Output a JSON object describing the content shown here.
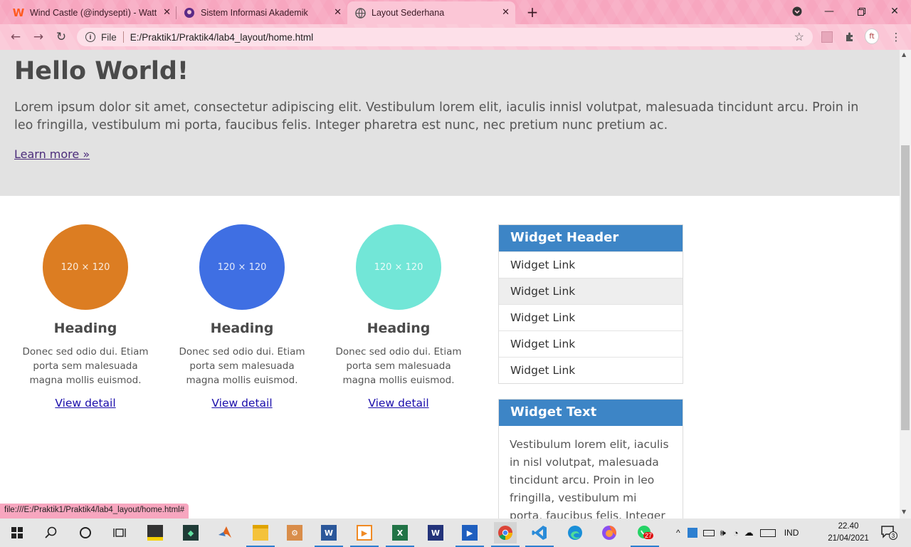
{
  "browser": {
    "tabs": [
      {
        "title": "Wind Castle (@indyseptì) - Wattp",
        "icon": "wattpad-icon",
        "active": false
      },
      {
        "title": "Sistem Informasi Akademik",
        "icon": "academic-icon",
        "active": false
      },
      {
        "title": "Layout Sederhana",
        "icon": "globe-icon",
        "active": true
      }
    ],
    "address": {
      "scheme_label": "File",
      "url": "E:/Praktik1/Praktik4/lab4_layout/home.html"
    },
    "status_url": "file:///E:/Praktik1/Praktik4/lab4_layout/home.html#",
    "theme_color": "#f7a6bf"
  },
  "page": {
    "jumbotron": {
      "title": "Hello World!",
      "text": "Lorem ipsum dolor sit amet, consectetur adipiscing elit. Vestibulum lorem elit, iaculis innisl volutpat, malesuada tincidunt arcu. Proin in leo fringilla, vestibulum mi porta, faucibus felis. Integer pharetra est nunc, nec pretium nunc pretium ac.",
      "link": "Learn more »"
    },
    "features": [
      {
        "placeholder": "120 × 120",
        "color": "#dc7d22",
        "heading": "Heading",
        "text": "Donec sed odio dui. Etiam porta sem malesuada magna mollis euismod.",
        "link": "View detail"
      },
      {
        "placeholder": "120 × 120",
        "color": "#3f6fe3",
        "heading": "Heading",
        "text": "Donec sed odio dui. Etiam porta sem malesuada magna mollis euismod.",
        "link": "View detail"
      },
      {
        "placeholder": "120 × 120",
        "color": "#72e6d7",
        "heading": "Heading",
        "text": "Donec sed odio dui. Etiam porta sem malesuada magna mollis euismod.",
        "link": "View detail"
      }
    ],
    "widget_links": {
      "header": "Widget Header",
      "links": [
        "Widget Link",
        "Widget Link",
        "Widget Link",
        "Widget Link",
        "Widget Link"
      ]
    },
    "widget_text": {
      "header": "Widget Text",
      "text": "Vestibulum lorem elit, iaculis in nisl volutpat, malesuada tincidunt arcu. Proin in leo fringilla, vestibulum mi porta, faucibus felis. Integer"
    },
    "accent_color": "#3d85c6"
  },
  "taskbar": {
    "apps": [
      "file-explorer-icon",
      "sticky-notes-icon",
      "app-icon",
      "matlab-icon",
      "folder-icon",
      "app-icon",
      "word-icon",
      "media-player-icon",
      "excel-icon",
      "app-icon",
      "movie-icon",
      "chrome-icon",
      "vscode-icon",
      "edge-icon",
      "firefox-icon",
      "whatsapp-icon"
    ],
    "whatsapp_badge": "27",
    "language": "IND",
    "time": "22.40",
    "date": "21/04/2021",
    "notifications": "3"
  }
}
